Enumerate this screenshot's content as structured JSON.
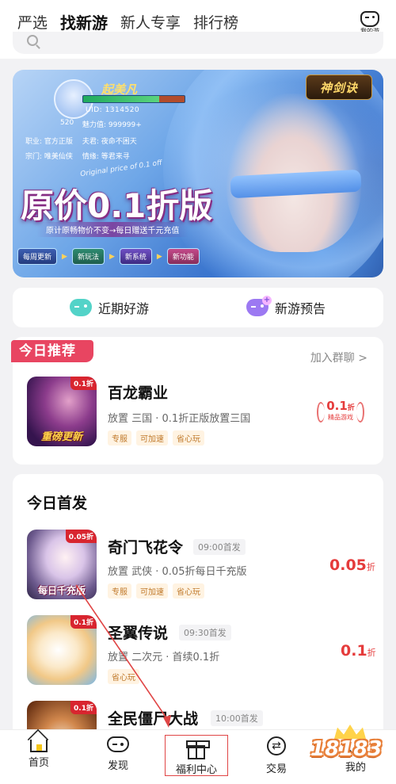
{
  "top_tabs": [
    {
      "label": "严选",
      "active": false
    },
    {
      "label": "找新游",
      "active": true
    },
    {
      "label": "新人专享",
      "active": false
    },
    {
      "label": "排行榜",
      "active": false
    }
  ],
  "my_games_label": "我的游戏",
  "banner": {
    "nickname": "起美凡",
    "uid": "UID: 1314520",
    "level": "520",
    "charm": "魅力值: 999999+",
    "info": [
      [
        "职业: 官方正版",
        "夫君: 夜命不困天"
      ],
      [
        "宗门: 唯美仙侠",
        "情缘: 等君来寻"
      ]
    ],
    "logo_text": "神剑诀",
    "en_text": "Original price of 0.1 off",
    "headline": "原价0.1折版",
    "subline": "原计原畅物价不变→每日赠送千元充值",
    "chips": [
      "每周更新",
      "新玩法",
      "新系统",
      "新功能"
    ]
  },
  "quick_entries": [
    {
      "label": "近期好游",
      "icon": "gamepad-icon",
      "color": "#53d3c8"
    },
    {
      "label": "新游预告",
      "icon": "gamepad-plus-icon",
      "color": "#9c79f2"
    }
  ],
  "recommend": {
    "tag": "今日推荐",
    "join": "加入群聊 >",
    "game": {
      "name": "百龙霸业",
      "badge": "0.1折",
      "icon_overlay": "重磅更新",
      "desc": "放置 三国 · 0.1折正版放置三国",
      "tags": [
        "专服",
        "可加速",
        "省心玩"
      ],
      "seal_value": "0.1",
      "seal_unit": "折",
      "seal_sub": "精品游戏"
    }
  },
  "launch": {
    "title": "今日首发",
    "games": [
      {
        "name": "奇门飞花令",
        "time": "09:00首发",
        "badge": "0.05折",
        "icon_overlay": "每日千充版",
        "desc": "放置 武侠 · 0.05折每日千充版",
        "tags": [
          "专服",
          "可加速",
          "省心玩"
        ],
        "price": "0.05",
        "unit": "折"
      },
      {
        "name": "圣翼传说",
        "time": "09:30首发",
        "badge": "0.1折",
        "icon_overlay": "",
        "desc": "放置 二次元 · 首续0.1折",
        "tags": [
          "省心玩"
        ],
        "price": "0.1",
        "unit": "折"
      },
      {
        "name": "全民僵尸大战",
        "time": "10:00首发",
        "badge": "0.1折",
        "icon_overlay": "",
        "desc": "",
        "tags": [],
        "price": "",
        "unit": ""
      }
    ]
  },
  "bottom_nav": [
    {
      "label": "首页",
      "icon": "home-icon"
    },
    {
      "label": "发现",
      "icon": "gamepad-icon"
    },
    {
      "label": "福利中心",
      "icon": "gift-icon",
      "highlighted": true
    },
    {
      "label": "交易",
      "icon": "trade-icon"
    },
    {
      "label": "我的",
      "icon": "user-icon"
    }
  ],
  "watermark": "18183",
  "colors": {
    "accent": "#f5c518",
    "price_red": "#e53b3b",
    "rec_tag": "#e84561",
    "highlight_border": "#e04545"
  }
}
